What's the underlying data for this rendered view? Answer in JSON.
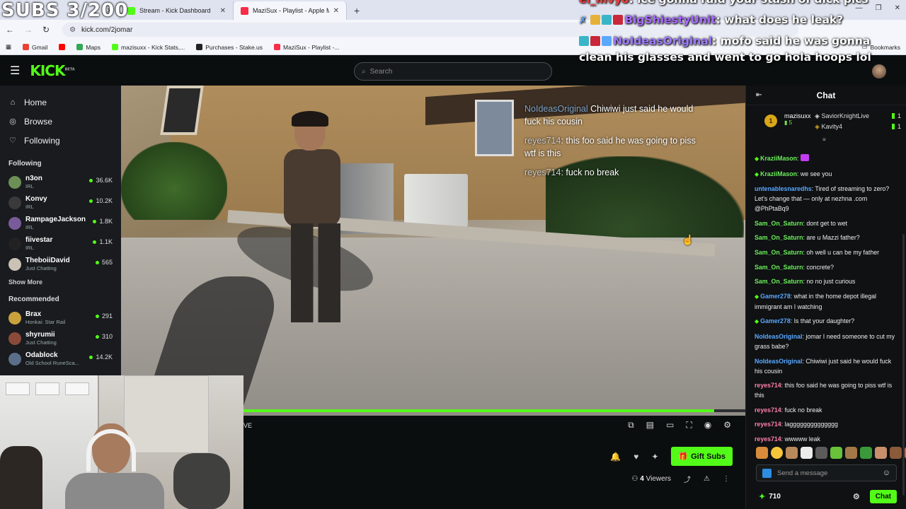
{
  "browser": {
    "tabs": [
      {
        "label": "Stream - Kick Dashboard",
        "color": "#53fc18",
        "active": false
      },
      {
        "label": "MaziSux - Playlist - Apple Music",
        "color": "#fa2d48",
        "active": true
      }
    ],
    "url": "kick.com/2jomar",
    "bookmarks": [
      {
        "label": "Gmail",
        "color": "#ea4335"
      },
      {
        "label": "",
        "color": "#ff0000"
      },
      {
        "label": "Maps",
        "color": "#34a853"
      },
      {
        "label": "mazisuxx - Kick Stats,...",
        "color": "#53fc18"
      },
      {
        "label": "Purchases - Stake.us",
        "color": "#222222"
      },
      {
        "label": "MaziSux - Playlist -...",
        "color": "#fa2d48"
      }
    ],
    "all_bookmarks": "Bookmarks"
  },
  "overlay": {
    "subs_counter": "SUBS 3/200",
    "obs_chat": [
      {
        "user": "el_mvyo",
        "text": "ice gonna raid your stash of dick pics",
        "user_color": "#ff3c3c"
      },
      {
        "user": "BigShiestyUnit",
        "text": "what does he leak?",
        "user_color": "#a86cff"
      },
      {
        "user": "NoIdeasOriginal",
        "text": "mofo said he was gonna clean his glasses and went to go hola hoops lol",
        "user_color": "#9f7bff"
      }
    ]
  },
  "header": {
    "logo": "KICK",
    "logo_sup": "BETA",
    "search_placeholder": "Search"
  },
  "sidebar": {
    "nav": [
      {
        "label": "Home",
        "icon": "home-icon"
      },
      {
        "label": "Browse",
        "icon": "compass-icon"
      },
      {
        "label": "Following",
        "icon": "heart-icon"
      }
    ],
    "following_title": "Following",
    "following": [
      {
        "name": "n3on",
        "category": "IRL",
        "viewers": "36.6K",
        "color": "#6c8f55"
      },
      {
        "name": "Konvy",
        "category": "IRL",
        "viewers": "10.2K",
        "color": "#3a3a3a"
      },
      {
        "name": "RampageJackson",
        "category": "IRL",
        "viewers": "1.8K",
        "color": "#7a5b9a"
      },
      {
        "name": "fiivestar",
        "category": "IRL",
        "viewers": "1.1K",
        "color": "#222222"
      },
      {
        "name": "TheboiiDavid",
        "category": "Just Chatting",
        "viewers": "565",
        "color": "#c9c2b5"
      }
    ],
    "show_more": "Show More",
    "recommended_title": "Recommended",
    "recommended": [
      {
        "name": "Brax",
        "category": "Honkai: Star Rail",
        "viewers": "291",
        "color": "#c9a23c"
      },
      {
        "name": "shyrumii",
        "category": "Just Chatting",
        "viewers": "310",
        "color": "#8a4a3a"
      },
      {
        "name": "Odablock",
        "category": "Old School RuneSca...",
        "viewers": "14.2K",
        "color": "#5b6f8a"
      }
    ]
  },
  "video": {
    "overlay_chat": [
      {
        "user": "NoIdeasOriginal",
        "text": "Chiwiwi just said he would fuck his cousin"
      },
      {
        "user": "reyes714",
        "text": "this foo said he was going to piss wtf is this"
      },
      {
        "user": "reyes714",
        "text": "fuck no break"
      }
    ],
    "progress": 0.95,
    "live_label": "VE"
  },
  "actions": {
    "gift_subs": "Gift Subs",
    "viewers": "4",
    "viewers_label": "Viewers"
  },
  "chat": {
    "title": "Chat",
    "pinned": {
      "rank": "1",
      "user": "mazisuxx",
      "subs": "5",
      "others": [
        {
          "name": "SaviorKnightLive",
          "count": "1"
        },
        {
          "name": "Kavity4",
          "count": "1"
        }
      ]
    },
    "messages": [
      {
        "user": "KraziiMason",
        "text": "",
        "color": "#6cef5a",
        "badge": true,
        "emote": true
      },
      {
        "user": "KraziiMason",
        "text": "we see you",
        "color": "#6cef5a",
        "badge": true
      },
      {
        "user": "untenablesnaredhs",
        "text": "Tired of streaming to zero? Let's change that — only at nezhna .com @PhPtaBq9",
        "color": "#5aa8ff",
        "badge": false
      },
      {
        "user": "Sam_On_Saturn",
        "text": "dont get to wet",
        "color": "#6cef5a",
        "badge": false
      },
      {
        "user": "Sam_On_Saturn",
        "text": "are u Mazzi father?",
        "color": "#6cef5a",
        "badge": false
      },
      {
        "user": "Sam_On_Saturn",
        "text": "oh well u can be my father",
        "color": "#6cef5a",
        "badge": false
      },
      {
        "user": "Sam_On_Saturn",
        "text": "concrete?",
        "color": "#6cef5a",
        "badge": false
      },
      {
        "user": "Sam_On_Saturn",
        "text": "no no just curious",
        "color": "#6cef5a",
        "badge": false
      },
      {
        "user": "Gamer278",
        "text": "what in the home depot illegal immigrant am I watching",
        "color": "#5aa8ff",
        "badge": true
      },
      {
        "user": "Gamer278",
        "text": "Is that your daughter?",
        "color": "#5aa8ff",
        "badge": true
      },
      {
        "user": "NoIdeasOriginal",
        "text": "jomar I need someone to cut my grass babe?",
        "color": "#5aa8ff",
        "badge": false
      },
      {
        "user": "NoIdeasOriginal",
        "text": "Chiwiwi just said he would fuck his cousin",
        "color": "#5aa8ff",
        "badge": false
      },
      {
        "user": "reyes714",
        "text": "this foo said he was going to piss wtf is this",
        "color": "#ff80a8",
        "badge": false
      },
      {
        "user": "reyes714",
        "text": "fuck no break",
        "color": "#ff80a8",
        "badge": false
      },
      {
        "user": "reyes714",
        "text": "lagggggggggggggg",
        "color": "#ff80a8",
        "badge": false
      },
      {
        "user": "reyes714",
        "text": "wwwww leak",
        "color": "#ff80a8",
        "badge": false
      }
    ],
    "input_placeholder": "Send a message",
    "points": "710",
    "send_label": "Chat"
  }
}
